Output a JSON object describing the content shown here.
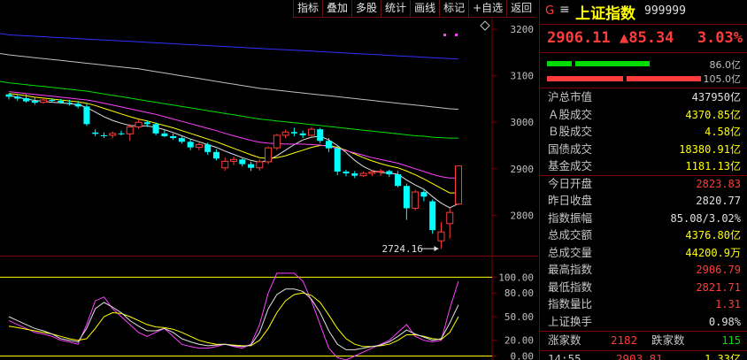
{
  "toolbar": {
    "items": [
      "指标",
      "叠加",
      "多股",
      "统计",
      "画线",
      "标记",
      "+自选",
      "返回"
    ]
  },
  "header": {
    "g_label": "G",
    "menu_glyph": "≡",
    "name": "上证指数",
    "code": "999999",
    "price": "2906.11",
    "change": "▲85.34",
    "change_pct": "3.03%"
  },
  "ratio_bars": {
    "top_value": "86.0亿",
    "bottom_value": "105.0亿"
  },
  "stats": [
    {
      "label": "沪总市值",
      "value": "437950亿",
      "color": "#e0e0e0"
    },
    {
      "label": "Ａ股成交",
      "value": "4370.85亿",
      "color": "#ffff00"
    },
    {
      "label": "Ｂ股成交",
      "value": "4.58亿",
      "color": "#ffff00"
    },
    {
      "label": "国债成交",
      "value": "18380.91亿",
      "color": "#ffff00"
    },
    {
      "label": "基金成交",
      "value": "1181.13亿",
      "color": "#ffff00"
    },
    {
      "label": "今日开盘",
      "value": "2823.83",
      "color": "#ff3b3b"
    },
    {
      "label": "昨日收盘",
      "value": "2820.77",
      "color": "#e0e0e0"
    },
    {
      "label": "指数振幅",
      "value": "85.08/3.02%",
      "color": "#e0e0e0"
    },
    {
      "label": "总成交额",
      "value": "4376.80亿",
      "color": "#ffff00"
    },
    {
      "label": "总成交量",
      "value": "44200.9万",
      "color": "#ffff00"
    },
    {
      "label": "最高指数",
      "value": "2906.79",
      "color": "#ff3b3b"
    },
    {
      "label": "最低指数",
      "value": "2821.71",
      "color": "#ff3b3b"
    },
    {
      "label": "指数量比",
      "value": "1.31",
      "color": "#ff3b3b"
    },
    {
      "label": "上证换手",
      "value": "0.98%",
      "color": "#e0e0e0"
    }
  ],
  "updown": {
    "up_label": "涨家数",
    "up_value": "2182",
    "down_label": "跌家数",
    "down_value": "115"
  },
  "tick": {
    "time": "14:55",
    "price": "2903.81",
    "volume": "1.33亿"
  },
  "chart_data": {
    "type": "candlestick",
    "price_axis": {
      "ticks": [
        3200,
        3100,
        3000,
        2900,
        2800
      ],
      "range": [
        2715,
        3225
      ]
    },
    "min_annotation": {
      "text": "2724.16",
      "value": 2724.16
    },
    "candles": [
      [
        3060,
        3062,
        3049,
        3055
      ],
      [
        3055,
        3059,
        3046,
        3051
      ],
      [
        3052,
        3060,
        3042,
        3045
      ],
      [
        3046,
        3053,
        3038,
        3042
      ],
      [
        3043,
        3052,
        3040,
        3048
      ],
      [
        3048,
        3052,
        3044,
        3046
      ],
      [
        3046,
        3050,
        3040,
        3042
      ],
      [
        3042,
        3048,
        3036,
        3040
      ],
      [
        3040,
        3046,
        3030,
        3034
      ],
      [
        3034,
        3042,
        2992,
        2996
      ],
      [
        2978,
        2985,
        2970,
        2975
      ],
      [
        2972,
        2978,
        2966,
        2970
      ],
      [
        2972,
        2980,
        2966,
        2976
      ],
      [
        2976,
        2982,
        2972,
        2975
      ],
      [
        2975,
        2996,
        2960,
        2990
      ],
      [
        2990,
        3006,
        2986,
        3000
      ],
      [
        3000,
        3004,
        2990,
        2996
      ],
      [
        2996,
        3000,
        2972,
        2976
      ],
      [
        2976,
        2984,
        2968,
        2970
      ],
      [
        2970,
        2976,
        2962,
        2966
      ],
      [
        2966,
        2972,
        2954,
        2958
      ],
      [
        2958,
        2964,
        2940,
        2946
      ],
      [
        2946,
        2956,
        2940,
        2952
      ],
      [
        2952,
        2956,
        2930,
        2936
      ],
      [
        2936,
        2942,
        2918,
        2922
      ],
      [
        2902,
        2924,
        2896,
        2916
      ],
      [
        2916,
        2926,
        2908,
        2920
      ],
      [
        2920,
        2925,
        2905,
        2910
      ],
      [
        2910,
        2915,
        2895,
        2902
      ],
      [
        2902,
        2920,
        2896,
        2915
      ],
      [
        2915,
        2948,
        2910,
        2945
      ],
      [
        2945,
        2975,
        2940,
        2972
      ],
      [
        2972,
        2984,
        2966,
        2979
      ],
      [
        2979,
        2988,
        2970,
        2976
      ],
      [
        2976,
        2982,
        2966,
        2972
      ],
      [
        2972,
        2990,
        2970,
        2985
      ],
      [
        2985,
        2988,
        2955,
        2960
      ],
      [
        2960,
        2966,
        2936,
        2944
      ],
      [
        2944,
        2950,
        2886,
        2894
      ],
      [
        2894,
        2898,
        2884,
        2890
      ],
      [
        2890,
        2895,
        2880,
        2885
      ],
      [
        2885,
        2894,
        2882,
        2890
      ],
      [
        2890,
        2898,
        2884,
        2893
      ],
      [
        2893,
        2900,
        2885,
        2895
      ],
      [
        2895,
        2898,
        2882,
        2888
      ],
      [
        2888,
        2895,
        2860,
        2863
      ],
      [
        2863,
        2868,
        2790,
        2815
      ],
      [
        2815,
        2855,
        2810,
        2850
      ],
      [
        2850,
        2855,
        2830,
        2840
      ],
      [
        2830,
        2834,
        2760,
        2768
      ],
      [
        2745,
        2785,
        2728,
        2764
      ],
      [
        2782,
        2815,
        2750,
        2806
      ],
      [
        2824,
        2907,
        2822,
        2906
      ]
    ],
    "ma": [
      {
        "name": "ma_white",
        "color": "#e0e0e0",
        "values": [
          3058,
          3054,
          3050,
          3047,
          3045,
          3043,
          3042,
          3040,
          3038,
          3032,
          3022,
          3012,
          3004,
          2998,
          2993,
          2992,
          2992,
          2989,
          2984,
          2978,
          2971,
          2964,
          2958,
          2952,
          2946,
          2938,
          2931,
          2924,
          2918,
          2914,
          2918,
          2928,
          2940,
          2952,
          2962,
          2968,
          2970,
          2962,
          2950,
          2935,
          2918,
          2905,
          2896,
          2892,
          2891,
          2888,
          2876,
          2865,
          2856,
          2840,
          2826,
          2816,
          2825
        ]
      },
      {
        "name": "ma_yellow",
        "color": "#ffff00",
        "values": [
          3062,
          3060,
          3057,
          3054,
          3052,
          3050,
          3048,
          3046,
          3044,
          3041,
          3036,
          3030,
          3024,
          3018,
          3012,
          3007,
          3003,
          2998,
          2993,
          2988,
          2982,
          2976,
          2970,
          2964,
          2958,
          2951,
          2944,
          2937,
          2930,
          2924,
          2922,
          2924,
          2928,
          2934,
          2940,
          2946,
          2950,
          2950,
          2946,
          2940,
          2932,
          2924,
          2917,
          2911,
          2906,
          2902,
          2895,
          2887,
          2878,
          2868,
          2858,
          2848,
          2848
        ]
      },
      {
        "name": "ma_magenta",
        "color": "#ff40ff",
        "values": [
          3066,
          3064,
          3062,
          3060,
          3058,
          3056,
          3054,
          3052,
          3050,
          3048,
          3045,
          3041,
          3037,
          3033,
          3029,
          3025,
          3021,
          3017,
          3012,
          3007,
          3002,
          2997,
          2992,
          2987,
          2982,
          2976,
          2971,
          2966,
          2961,
          2957,
          2955,
          2954,
          2953,
          2953,
          2953,
          2952,
          2951,
          2948,
          2944,
          2939,
          2934,
          2929,
          2924,
          2920,
          2916,
          2912,
          2906,
          2900,
          2894,
          2888,
          2883,
          2880,
          2880
        ]
      },
      {
        "name": "ma_green",
        "color": "#00e000",
        "values": [
          3085,
          3083,
          3081,
          3079,
          3077,
          3075,
          3073,
          3071,
          3069,
          3067,
          3064,
          3061,
          3058,
          3055,
          3052,
          3049,
          3046,
          3043,
          3040,
          3037,
          3034,
          3031,
          3028,
          3025,
          3022,
          3019,
          3016,
          3013,
          3010,
          3007,
          3005,
          3003,
          3001,
          2999,
          2997,
          2995,
          2993,
          2991,
          2989,
          2987,
          2985,
          2983,
          2981,
          2979,
          2977,
          2975,
          2973,
          2971,
          2970,
          2968,
          2967,
          2966,
          2966
        ]
      },
      {
        "name": "ma_gray",
        "color": "#c0c0c0",
        "values": [
          3145,
          3143,
          3141,
          3139,
          3137,
          3135,
          3133,
          3131,
          3129,
          3127,
          3125,
          3123,
          3121,
          3119,
          3117,
          3115,
          3112,
          3109,
          3106,
          3103,
          3100,
          3097,
          3094,
          3091,
          3088,
          3085,
          3082,
          3079,
          3076,
          3073,
          3071,
          3069,
          3067,
          3065,
          3063,
          3061,
          3059,
          3057,
          3055,
          3053,
          3051,
          3049,
          3047,
          3045,
          3043,
          3041,
          3039,
          3037,
          3035,
          3033,
          3031,
          3029,
          3028
        ]
      },
      {
        "name": "ma_blue",
        "color": "#3030ff",
        "values": [
          3188,
          3187,
          3186,
          3185,
          3184,
          3183,
          3182,
          3181,
          3180,
          3179,
          3178,
          3177,
          3176,
          3175,
          3174,
          3173,
          3172,
          3171,
          3170,
          3169,
          3168,
          3167,
          3166,
          3165,
          3164,
          3163,
          3162,
          3161,
          3160,
          3159,
          3158,
          3157,
          3156,
          3155,
          3154,
          3153,
          3152,
          3151,
          3150,
          3149,
          3148,
          3147,
          3146,
          3145,
          3144,
          3143,
          3142,
          3141,
          3140,
          3139,
          3138,
          3137,
          3136
        ]
      }
    ],
    "oscillator": {
      "ticks": [
        100.0,
        80.0,
        50.0,
        20.0,
        0.0
      ],
      "range": [
        -5,
        115
      ],
      "series": [
        {
          "name": "osc_k",
          "color": "#ff40ff",
          "values": [
            45,
            40,
            35,
            30,
            28,
            25,
            20,
            18,
            15,
            40,
            70,
            75,
            60,
            50,
            40,
            30,
            25,
            30,
            35,
            25,
            15,
            12,
            10,
            10,
            12,
            15,
            12,
            10,
            15,
            40,
            80,
            105,
            105,
            105,
            95,
            70,
            40,
            10,
            -2,
            -5,
            0,
            5,
            10,
            15,
            20,
            30,
            40,
            25,
            20,
            18,
            20,
            60,
            95
          ]
        },
        {
          "name": "osc_d",
          "color": "#ffff00",
          "values": [
            38,
            36,
            34,
            32,
            30,
            28,
            25,
            22,
            20,
            22,
            35,
            50,
            55,
            54,
            50,
            45,
            40,
            37,
            36,
            34,
            30,
            25,
            20,
            17,
            15,
            15,
            14,
            13,
            13,
            20,
            35,
            55,
            70,
            78,
            80,
            77,
            68,
            52,
            35,
            22,
            15,
            12,
            12,
            13,
            15,
            20,
            27,
            27,
            25,
            22,
            21,
            30,
            50
          ]
        },
        {
          "name": "osc_j",
          "color": "#e0e0e0",
          "values": [
            50,
            45,
            40,
            35,
            32,
            28,
            22,
            20,
            18,
            35,
            60,
            68,
            62,
            55,
            45,
            38,
            32,
            32,
            35,
            30,
            22,
            18,
            15,
            13,
            14,
            15,
            13,
            12,
            14,
            30,
            60,
            78,
            85,
            85,
            82,
            72,
            55,
            32,
            15,
            8,
            8,
            10,
            12,
            14,
            18,
            25,
            33,
            28,
            24,
            20,
            22,
            42,
            65
          ]
        }
      ]
    }
  }
}
